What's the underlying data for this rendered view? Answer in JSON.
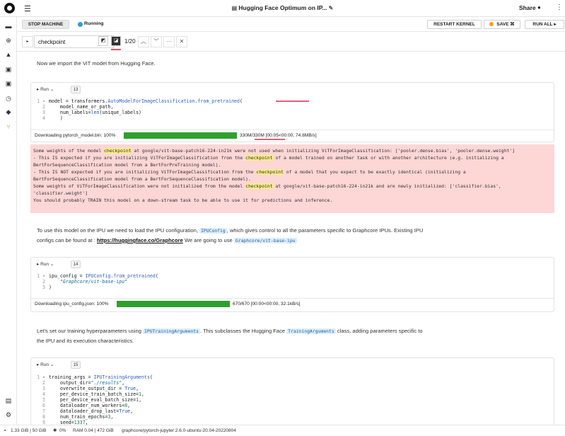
{
  "header": {
    "title": "Hugging Face Optimum on IP...",
    "share_label": "Share"
  },
  "toolbar": {
    "stop_label": "STOP MACHINE",
    "status_label": "Running",
    "restart_label": "RESTART KERNEL",
    "save_label": "SAVE",
    "run_all_label": "RUN ALL"
  },
  "search": {
    "value": "checkpoint",
    "count": "1/20"
  },
  "cells": {
    "intro_text": "Now we import the ViT model from Hugging Face.",
    "cell13": {
      "run_label": "Run",
      "exec_count": "13",
      "progress_label": "Downloading pytorch_model.bin: 100%",
      "progress_value": 1.0,
      "progress_stats": "330M/330M [00:05<00:00, 74.8MB/s]"
    },
    "cell14": {
      "run_label": "Run",
      "exec_count": "14",
      "progress_label": "Downloading ipu_config.json: 100%",
      "progress_value": 1.0,
      "progress_stats": "670/670 [00:00<00:00, 32.1kB/s]"
    },
    "cell15": {
      "run_label": "Run",
      "exec_count": "15"
    },
    "ipu_text_1": "To use this model on the IPU we need to load the IPU configuration,",
    "ipu_config_tag": "IPUConfig",
    "ipu_text_2": ", which gives control to all the parameters specific to Graphcore IPUs. Existing IPU",
    "ipu_text_3": "configs can be found at :",
    "ipu_link": "https://huggingface.co/Graphcore",
    "ipu_text_4": "We are going to use",
    "ipu_vit_tag": "Graphcore/vit-base-ipu",
    "train_text_1": "Let's set our training hyperparameters using",
    "train_tag_1": "IPUTrainingArguments",
    "train_text_2": ". This subclasses the Hugging Face",
    "train_tag_2": "TrainingArguments",
    "train_text_3": "class, adding parameters specific to",
    "train_text_4": "the IPU and its execution characteristics."
  },
  "status_bar": {
    "disk": "1.33 GiB | 50 GiB",
    "cpu": "0%",
    "ram": "RAM 0.04 | 472 GiB",
    "image": "graphcore/pytorch-jupyter:2.6.0-ubuntu-20.04-20220804"
  },
  "colors": {
    "progress": "#2ea02e",
    "stderr_bg": "#fdd6d6",
    "match_highlight": "#f6ec87",
    "running": "#2b9fd6",
    "save_dot": "#f0a02a"
  }
}
